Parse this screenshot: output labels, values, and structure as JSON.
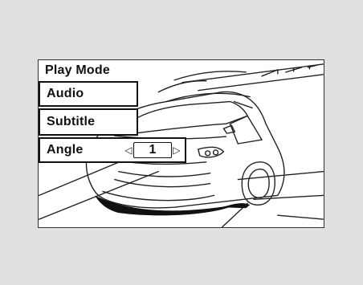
{
  "menu": {
    "title": "Play Mode",
    "items": [
      {
        "label": "Audio"
      },
      {
        "label": "Subtitle"
      },
      {
        "label": "Angle"
      }
    ],
    "angle": {
      "value": "1",
      "left_arrow": "◁",
      "right_arrow": "▷"
    }
  }
}
